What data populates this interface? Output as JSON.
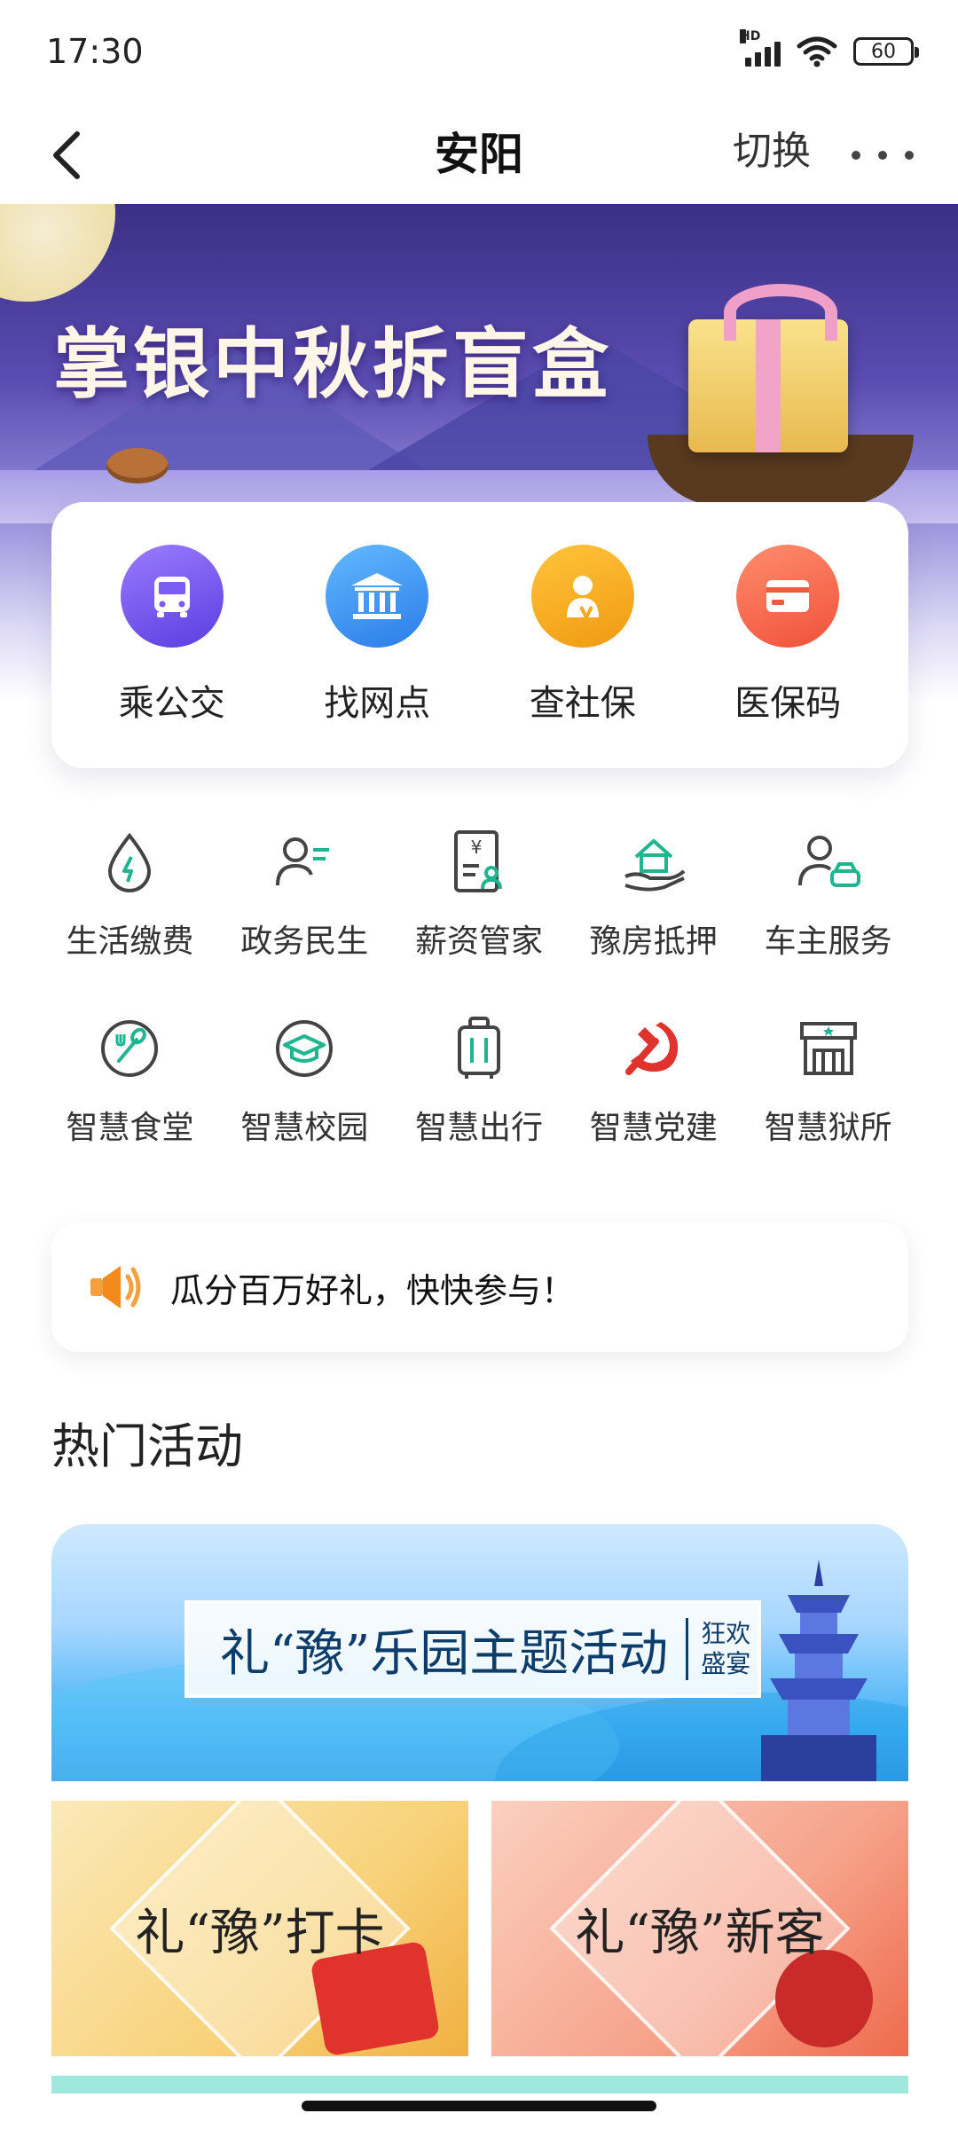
{
  "status_bar": {
    "time": "17:30",
    "network": "HD",
    "battery": "60"
  },
  "nav": {
    "title": "安阳",
    "switch_label": "切换",
    "back_icon": "chevron-left-icon",
    "more_icon": "more-horizontal-icon"
  },
  "banner": {
    "title": "掌银中秋拆盲盒"
  },
  "quick_actions": [
    {
      "label": "乘公交",
      "icon": "bus-icon",
      "color": "#6a4cf0"
    },
    {
      "label": "找网点",
      "icon": "bank-icon",
      "color": "#2f86ec"
    },
    {
      "label": "查社保",
      "icon": "social-security-icon",
      "color": "#f5a81c"
    },
    {
      "label": "医保码",
      "icon": "card-icon",
      "color": "#f25a40"
    }
  ],
  "services": [
    {
      "label": "生活缴费",
      "icon": "utility-drop-icon"
    },
    {
      "label": "政务民生",
      "icon": "person-list-icon"
    },
    {
      "label": "薪资管家",
      "icon": "salary-doc-icon"
    },
    {
      "label": "豫房抵押",
      "icon": "house-hand-icon"
    },
    {
      "label": "车主服务",
      "icon": "person-car-icon"
    },
    {
      "label": "智慧食堂",
      "icon": "canteen-icon"
    },
    {
      "label": "智慧校园",
      "icon": "graduation-cap-icon"
    },
    {
      "label": "智慧出行",
      "icon": "luggage-icon"
    },
    {
      "label": "智慧党建",
      "icon": "party-emblem-icon"
    },
    {
      "label": "智慧狱所",
      "icon": "building-star-icon"
    }
  ],
  "notice": {
    "text": "瓜分百万好礼，快快参与！",
    "icon": "speaker-icon"
  },
  "section": {
    "title": "热门活动"
  },
  "activities": {
    "main": {
      "title": "礼“豫”乐园主题活动",
      "subtitle": "狂欢盛宴"
    },
    "cards": [
      {
        "title": "礼“豫”打卡"
      },
      {
        "title": "礼“豫”新客"
      }
    ]
  },
  "colors": {
    "accent_green": "#1fb58f",
    "text_primary": "#222222",
    "party_red": "#e0332d"
  }
}
